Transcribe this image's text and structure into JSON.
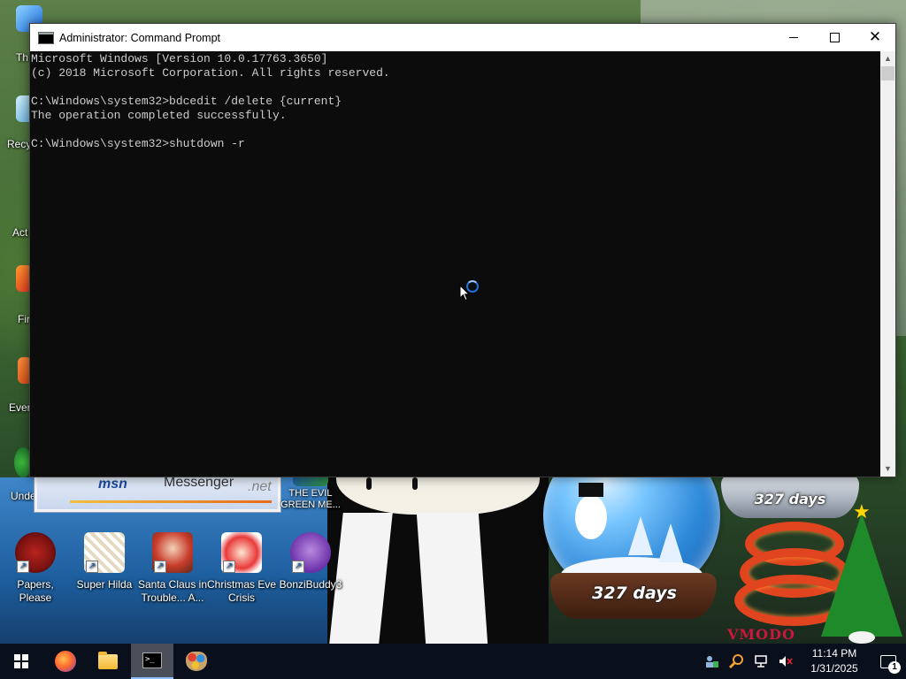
{
  "desktop": {
    "icons": [
      {
        "id": "papers-please",
        "label": "Papers, Please"
      },
      {
        "id": "super-hilda",
        "label": "Super Hilda"
      },
      {
        "id": "santa-claus",
        "label": "Santa Claus in Trouble... A..."
      },
      {
        "id": "christmas-eve",
        "label": "Christmas Eve Crisis"
      },
      {
        "id": "bonzibuddy",
        "label": "BonziBuddy3"
      },
      {
        "id": "evil-green",
        "label": "THE EVIL GREEN ME..."
      }
    ],
    "partial_labels": [
      "Th",
      "Recy",
      "Act",
      "Fir",
      "Ever",
      "Unde"
    ],
    "messenger": {
      "brand": "msn",
      "text": "Messenger",
      "suffix": ".net"
    },
    "snow_globes": [
      {
        "days_label": "327 days"
      },
      {
        "days_label": "327 days"
      }
    ],
    "decoration_text": "VMODO"
  },
  "cmd": {
    "title": "Administrator: Command Prompt",
    "lines": [
      "Microsoft Windows [Version 10.0.17763.3650]",
      "(c) 2018 Microsoft Corporation. All rights reserved.",
      "",
      "C:\\Windows\\system32>bdcedit /delete {current}",
      "The operation completed successfully.",
      "",
      "C:\\Windows\\system32>shutdown -r"
    ],
    "caption": {
      "minimize": "–",
      "maximize": "□",
      "close": "✕"
    }
  },
  "taskbar": {
    "items": [
      {
        "name": "start-button",
        "icon": "windows-logo-icon"
      },
      {
        "name": "firefox-button",
        "icon": "firefox-icon"
      },
      {
        "name": "file-explorer-button",
        "icon": "folder-icon"
      },
      {
        "name": "command-prompt-button",
        "icon": "cmd-icon",
        "active": true
      },
      {
        "name": "paint-button",
        "icon": "paint-icon"
      }
    ],
    "clock": {
      "time": "11:14 PM",
      "date": "1/31/2025"
    },
    "notifications_count": "1"
  },
  "colors": {
    "taskbar_bg": "#0a0f1c",
    "console_bg": "#0c0c0c",
    "console_fg": "#cccccc",
    "accent": "#1f6fe0"
  }
}
